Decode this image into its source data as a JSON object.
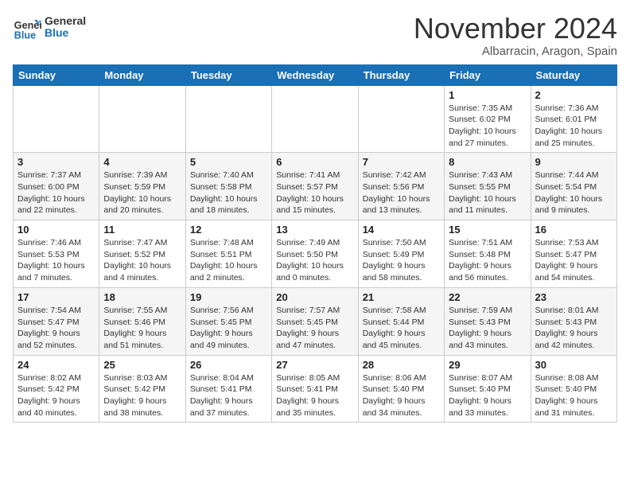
{
  "logo": {
    "text_general": "General",
    "text_blue": "Blue"
  },
  "header": {
    "month": "November 2024",
    "location": "Albarracin, Aragon, Spain"
  },
  "weekdays": [
    "Sunday",
    "Monday",
    "Tuesday",
    "Wednesday",
    "Thursday",
    "Friday",
    "Saturday"
  ],
  "weeks": [
    [
      {
        "day": "",
        "info": ""
      },
      {
        "day": "",
        "info": ""
      },
      {
        "day": "",
        "info": ""
      },
      {
        "day": "",
        "info": ""
      },
      {
        "day": "",
        "info": ""
      },
      {
        "day": "1",
        "info": "Sunrise: 7:35 AM\nSunset: 6:02 PM\nDaylight: 10 hours\nand 27 minutes."
      },
      {
        "day": "2",
        "info": "Sunrise: 7:36 AM\nSunset: 6:01 PM\nDaylight: 10 hours\nand 25 minutes."
      }
    ],
    [
      {
        "day": "3",
        "info": "Sunrise: 7:37 AM\nSunset: 6:00 PM\nDaylight: 10 hours\nand 22 minutes."
      },
      {
        "day": "4",
        "info": "Sunrise: 7:39 AM\nSunset: 5:59 PM\nDaylight: 10 hours\nand 20 minutes."
      },
      {
        "day": "5",
        "info": "Sunrise: 7:40 AM\nSunset: 5:58 PM\nDaylight: 10 hours\nand 18 minutes."
      },
      {
        "day": "6",
        "info": "Sunrise: 7:41 AM\nSunset: 5:57 PM\nDaylight: 10 hours\nand 15 minutes."
      },
      {
        "day": "7",
        "info": "Sunrise: 7:42 AM\nSunset: 5:56 PM\nDaylight: 10 hours\nand 13 minutes."
      },
      {
        "day": "8",
        "info": "Sunrise: 7:43 AM\nSunset: 5:55 PM\nDaylight: 10 hours\nand 11 minutes."
      },
      {
        "day": "9",
        "info": "Sunrise: 7:44 AM\nSunset: 5:54 PM\nDaylight: 10 hours\nand 9 minutes."
      }
    ],
    [
      {
        "day": "10",
        "info": "Sunrise: 7:46 AM\nSunset: 5:53 PM\nDaylight: 10 hours\nand 7 minutes."
      },
      {
        "day": "11",
        "info": "Sunrise: 7:47 AM\nSunset: 5:52 PM\nDaylight: 10 hours\nand 4 minutes."
      },
      {
        "day": "12",
        "info": "Sunrise: 7:48 AM\nSunset: 5:51 PM\nDaylight: 10 hours\nand 2 minutes."
      },
      {
        "day": "13",
        "info": "Sunrise: 7:49 AM\nSunset: 5:50 PM\nDaylight: 10 hours\nand 0 minutes."
      },
      {
        "day": "14",
        "info": "Sunrise: 7:50 AM\nSunset: 5:49 PM\nDaylight: 9 hours\nand 58 minutes."
      },
      {
        "day": "15",
        "info": "Sunrise: 7:51 AM\nSunset: 5:48 PM\nDaylight: 9 hours\nand 56 minutes."
      },
      {
        "day": "16",
        "info": "Sunrise: 7:53 AM\nSunset: 5:47 PM\nDaylight: 9 hours\nand 54 minutes."
      }
    ],
    [
      {
        "day": "17",
        "info": "Sunrise: 7:54 AM\nSunset: 5:47 PM\nDaylight: 9 hours\nand 52 minutes."
      },
      {
        "day": "18",
        "info": "Sunrise: 7:55 AM\nSunset: 5:46 PM\nDaylight: 9 hours\nand 51 minutes."
      },
      {
        "day": "19",
        "info": "Sunrise: 7:56 AM\nSunset: 5:45 PM\nDaylight: 9 hours\nand 49 minutes."
      },
      {
        "day": "20",
        "info": "Sunrise: 7:57 AM\nSunset: 5:45 PM\nDaylight: 9 hours\nand 47 minutes."
      },
      {
        "day": "21",
        "info": "Sunrise: 7:58 AM\nSunset: 5:44 PM\nDaylight: 9 hours\nand 45 minutes."
      },
      {
        "day": "22",
        "info": "Sunrise: 7:59 AM\nSunset: 5:43 PM\nDaylight: 9 hours\nand 43 minutes."
      },
      {
        "day": "23",
        "info": "Sunrise: 8:01 AM\nSunset: 5:43 PM\nDaylight: 9 hours\nand 42 minutes."
      }
    ],
    [
      {
        "day": "24",
        "info": "Sunrise: 8:02 AM\nSunset: 5:42 PM\nDaylight: 9 hours\nand 40 minutes."
      },
      {
        "day": "25",
        "info": "Sunrise: 8:03 AM\nSunset: 5:42 PM\nDaylight: 9 hours\nand 38 minutes."
      },
      {
        "day": "26",
        "info": "Sunrise: 8:04 AM\nSunset: 5:41 PM\nDaylight: 9 hours\nand 37 minutes."
      },
      {
        "day": "27",
        "info": "Sunrise: 8:05 AM\nSunset: 5:41 PM\nDaylight: 9 hours\nand 35 minutes."
      },
      {
        "day": "28",
        "info": "Sunrise: 8:06 AM\nSunset: 5:40 PM\nDaylight: 9 hours\nand 34 minutes."
      },
      {
        "day": "29",
        "info": "Sunrise: 8:07 AM\nSunset: 5:40 PM\nDaylight: 9 hours\nand 33 minutes."
      },
      {
        "day": "30",
        "info": "Sunrise: 8:08 AM\nSunset: 5:40 PM\nDaylight: 9 hours\nand 31 minutes."
      }
    ]
  ]
}
